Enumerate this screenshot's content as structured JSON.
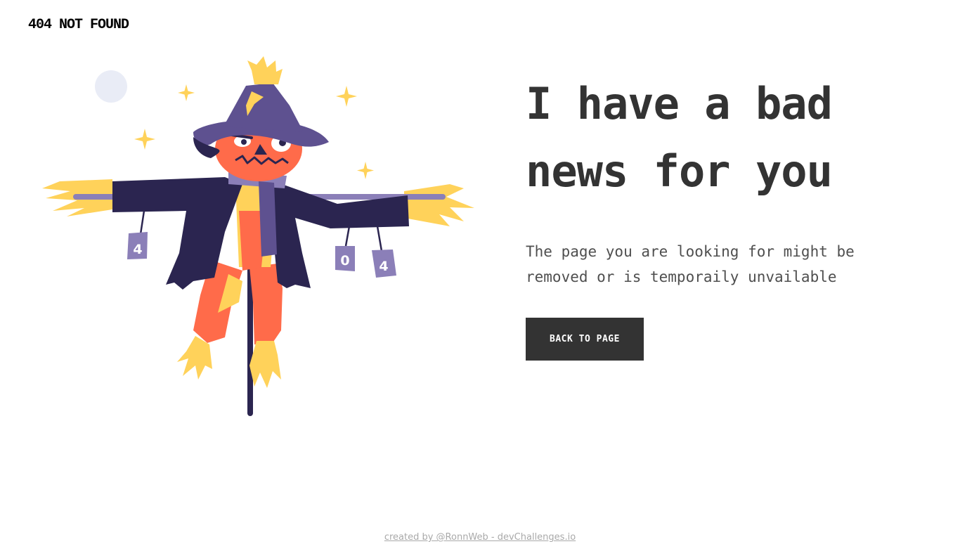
{
  "header": {
    "brand": "404 NOT FOUND"
  },
  "illustration": {
    "subject": "scarecrow",
    "cans": [
      "4",
      "0",
      "4"
    ],
    "colors": {
      "coat": "#2b2550",
      "hat": "#5e5190",
      "face": "#ff6b4a",
      "straw": "#ffd25a",
      "can": "#8b7fb8",
      "moon": "#e9ecf6"
    }
  },
  "main": {
    "headline_line1": "I have a bad",
    "headline_line2": "news for you",
    "message": "The page you are looking for might be removed or is temporaily unvailable",
    "back_button_label": "BACK TO PAGE"
  },
  "footer": {
    "credit": "created by @RonnWeb - devChallenges.io"
  },
  "colors": {
    "text": "#333333",
    "button_bg": "#333333",
    "button_text": "#ffffff",
    "footer_text": "#a9a9a9"
  }
}
